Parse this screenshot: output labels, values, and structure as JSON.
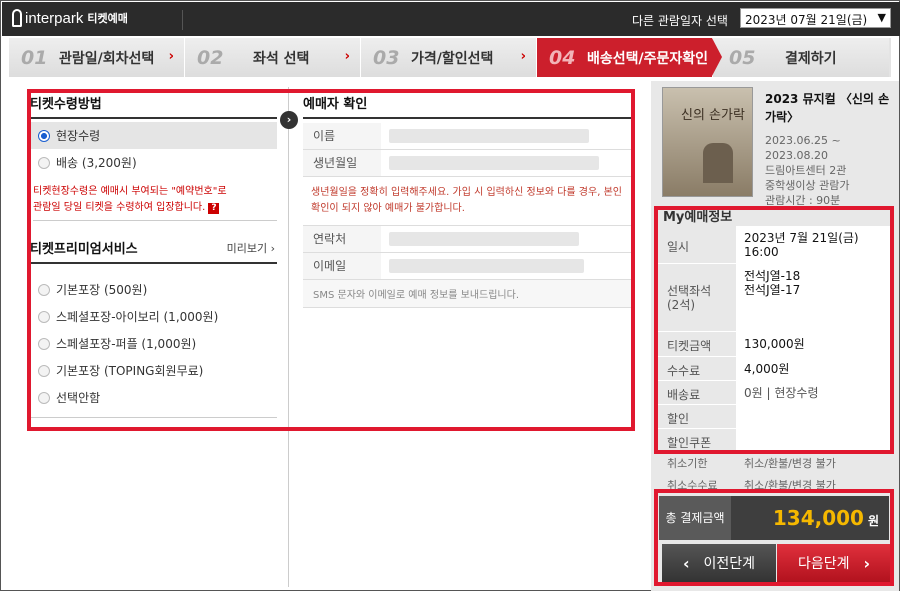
{
  "topbar": {
    "logo": "interpark",
    "logo_sub": "티켓예매",
    "date_label": "다른 관람일자 선택",
    "date_value": "2023년 07월 21일(금)"
  },
  "steps": [
    {
      "num": "01",
      "label": "관람일/회차선택"
    },
    {
      "num": "02",
      "label": "좌석 선택"
    },
    {
      "num": "03",
      "label": "가격/할인선택"
    },
    {
      "num": "04",
      "label": "배송선택/주문자확인"
    },
    {
      "num": "05",
      "label": "결제하기"
    }
  ],
  "receive": {
    "title": "티켓수령방법",
    "options": [
      "현장수령",
      "배송 (3,200원)"
    ],
    "notice_1": "티켓현장수령은 예매시 부여되는 \"예약번호\"로",
    "notice_2": "관람일 당일 티켓을 수령하여 입장합니다."
  },
  "premium": {
    "title": "티켓프리미엄서비스",
    "preview": "미리보기",
    "options": [
      "기본포장 (500원)",
      "스페셜포장-아이보리 (1,000원)",
      "스페셜포장-퍼플 (1,000원)",
      "기본포장 (TOPING회원무료)",
      "선택안함"
    ]
  },
  "booker": {
    "title": "예매자 확인",
    "name_label": "이름",
    "birth_label": "생년월일",
    "warning": "생년월일을 정확히 입력해주세요. 가입 시 입력하신 정보와 다를 경우, 본인확인이 되지 않아 예매가 불가합니다.",
    "phone_label": "연락처",
    "email_label": "이메일",
    "sms_note": "SMS 문자와 이메일로 예매 정보를 보내드립니다."
  },
  "show": {
    "title": "2023 뮤지컬 〈신의 손가락〉",
    "poster_text": "신의 손가락",
    "period": "2023.06.25 ~ 2023.08.20",
    "venue": "드림아트센터 2관",
    "age": "중학생이상 관람가",
    "runtime": "관람시간 : 90분"
  },
  "my": {
    "title": "My예매정보",
    "date_label": "일시",
    "date_value": "2023년 7월 21일(금)",
    "time_value": "16:00",
    "seat_label": "선택좌석",
    "seat_count": "(2석)",
    "seat_1": "전석J열-18",
    "seat_2": "전석J열-17",
    "ticket_label": "티켓금액",
    "ticket_value": "130,000원",
    "fee_label": "수수료",
    "fee_value": "4,000원",
    "delivery_label": "배송료",
    "delivery_value": "0원 | 현장수령",
    "discount_label": "할인",
    "coupon_label": "할인쿠폰",
    "cancel_deadline_label": "취소기한",
    "cancel_deadline_value": "취소/환불/변경 불가",
    "cancel_fee_label": "취소수수료",
    "cancel_fee_value": "취소/환불/변경 불가"
  },
  "total": {
    "label": "총 결제금액",
    "amount": "134,000",
    "unit": "원"
  },
  "buttons": {
    "prev": "이전단계",
    "next": "다음단계"
  },
  "colors": {
    "accent": "#cc1f2c",
    "annotation": "#e0182f",
    "total": "#f5b800"
  }
}
